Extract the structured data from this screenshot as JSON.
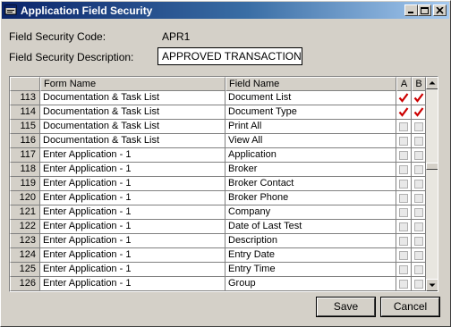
{
  "window": {
    "title": "Application Field Security",
    "controls": [
      "minimize-icon",
      "maximize-icon",
      "close-icon"
    ]
  },
  "form": {
    "code_label": "Field Security Code:",
    "code_value": "APR1",
    "description_label": "Field Security Description:",
    "description_value": "APPROVED TRANSACTION"
  },
  "grid": {
    "columns": [
      "",
      "Form Name",
      "Field Name",
      "A",
      "B"
    ],
    "rows": [
      {
        "num": "113",
        "form": "Documentation & Task List",
        "field": "Document List",
        "a": true,
        "b": true
      },
      {
        "num": "114",
        "form": "Documentation & Task List",
        "field": "Document Type",
        "a": true,
        "b": true
      },
      {
        "num": "115",
        "form": "Documentation & Task List",
        "field": "Print All",
        "a": false,
        "b": false
      },
      {
        "num": "116",
        "form": "Documentation & Task List",
        "field": "View All",
        "a": false,
        "b": false
      },
      {
        "num": "117",
        "form": "Enter Application -  1",
        "field": "Application",
        "a": false,
        "b": false
      },
      {
        "num": "118",
        "form": "Enter Application -  1",
        "field": "Broker",
        "a": false,
        "b": false
      },
      {
        "num": "119",
        "form": "Enter Application -  1",
        "field": "Broker Contact",
        "a": false,
        "b": false
      },
      {
        "num": "120",
        "form": "Enter Application -  1",
        "field": "Broker Phone",
        "a": false,
        "b": false
      },
      {
        "num": "121",
        "form": "Enter Application -  1",
        "field": "Company",
        "a": false,
        "b": false
      },
      {
        "num": "122",
        "form": "Enter Application -  1",
        "field": "Date of Last Test",
        "a": false,
        "b": false
      },
      {
        "num": "123",
        "form": "Enter Application -  1",
        "field": "Description",
        "a": false,
        "b": false
      },
      {
        "num": "124",
        "form": "Enter Application -  1",
        "field": "Entry Date",
        "a": false,
        "b": false
      },
      {
        "num": "125",
        "form": "Enter Application -  1",
        "field": "Entry Time",
        "a": false,
        "b": false
      },
      {
        "num": "126",
        "form": "Enter Application -  1",
        "field": "Group",
        "a": false,
        "b": false
      }
    ]
  },
  "buttons": {
    "save": "Save",
    "cancel": "Cancel"
  },
  "colors": {
    "check": "#cc0000",
    "title_start": "#0a246a",
    "title_end": "#a6caf0"
  }
}
